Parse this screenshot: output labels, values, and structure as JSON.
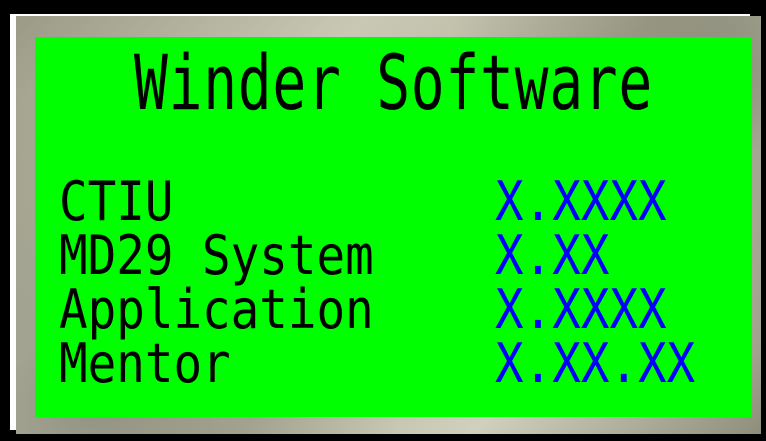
{
  "display": {
    "title": "Winder Software",
    "colors": {
      "screen_background": "#00ff00",
      "label_text": "#000000",
      "value_text": "#0000ff"
    },
    "rows": [
      {
        "label": "CTIU",
        "value": "X.XXXX"
      },
      {
        "label": "MD29 System",
        "value": "X.XX"
      },
      {
        "label": "Application",
        "value": "X.XXXX"
      },
      {
        "label": "Mentor",
        "value": "X.XX.XX"
      }
    ]
  }
}
